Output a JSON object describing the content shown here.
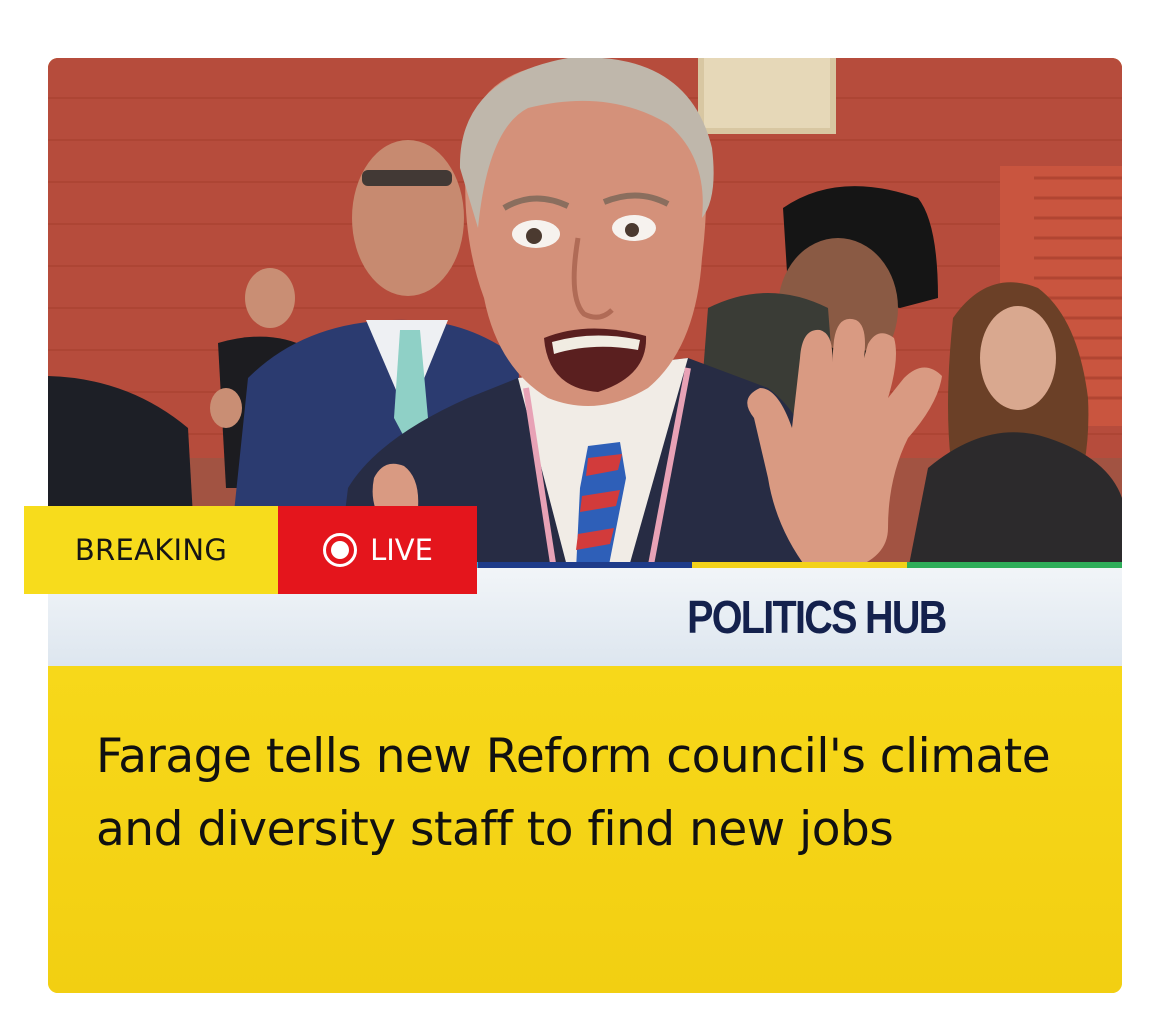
{
  "badges": {
    "breaking": "BREAKING",
    "live": "LIVE",
    "live_icon": "live-record-icon"
  },
  "hub": {
    "title": "POLITICS HUB"
  },
  "headline": {
    "text": "Farage tells new Reform council's climate and diversity staff to find new jobs"
  },
  "colors": {
    "breaking_bg": "#f7dc1c",
    "live_bg": "#e4151c",
    "headline_bg": "#f4d21a",
    "hub_text": "#14214d",
    "stripe": [
      "#f3b019",
      "#2aa7d8",
      "#1f3c8a",
      "#f3d21a",
      "#2fae5a"
    ]
  }
}
